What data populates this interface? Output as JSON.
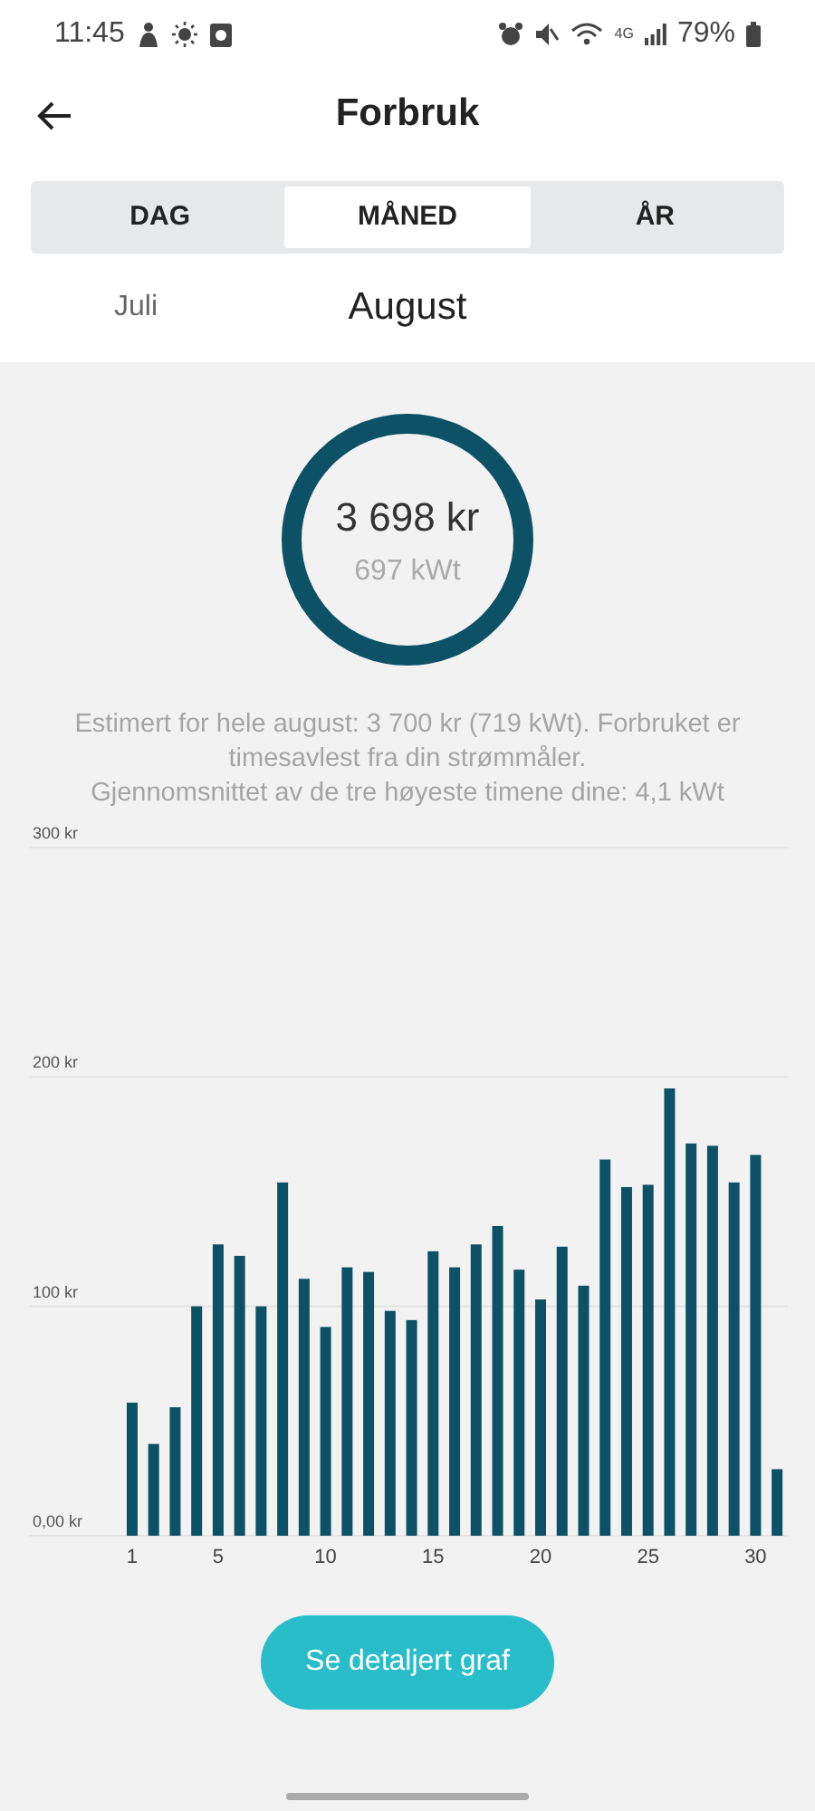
{
  "status_bar": {
    "time": "11:45",
    "network": "4G",
    "battery": "79%"
  },
  "header": {
    "title": "Forbruk"
  },
  "tabs": [
    {
      "label": "DAG",
      "selected": false
    },
    {
      "label": "MÅNED",
      "selected": true
    },
    {
      "label": "ÅR",
      "selected": false
    }
  ],
  "months": [
    {
      "label": "Juli",
      "selected": false
    },
    {
      "label": "August",
      "selected": true
    }
  ],
  "summary": {
    "amount": "3 698 kr",
    "energy": "697 kWt"
  },
  "info_text": "Estimert for hele august: 3 700 kr (719 kWt). Forbruket er timesavlest fra din strømmåler.\nGjennomsnittet av de tre høyeste timene dine: 4,1 kWt",
  "chart_data": {
    "type": "bar",
    "x": [
      1,
      2,
      3,
      4,
      5,
      6,
      7,
      8,
      9,
      10,
      11,
      12,
      13,
      14,
      15,
      16,
      17,
      18,
      19,
      20,
      21,
      22,
      23,
      24,
      25,
      26,
      27,
      28,
      29,
      30,
      31
    ],
    "series": [
      {
        "color": "#0d5166",
        "values": [
          58,
          40,
          56,
          100,
          127,
          122,
          100,
          154,
          112,
          91,
          117,
          115,
          98,
          94,
          124,
          117,
          127,
          135,
          116,
          103,
          126,
          109,
          164,
          152,
          153,
          195,
          171,
          170,
          154,
          166,
          29
        ]
      }
    ],
    "xlim": [
      -3.8,
      31.5
    ],
    "ylim": [
      0,
      300
    ],
    "yticks": [
      {
        "value": 0,
        "label": "0,00 kr"
      },
      {
        "value": 100,
        "label": "100 kr"
      },
      {
        "value": 200,
        "label": "200 kr"
      },
      {
        "value": 300,
        "label": "300 kr"
      }
    ],
    "xticks": [
      1,
      5,
      10,
      15,
      20,
      25,
      30
    ]
  },
  "button": {
    "label": "Se detaljert graf"
  }
}
